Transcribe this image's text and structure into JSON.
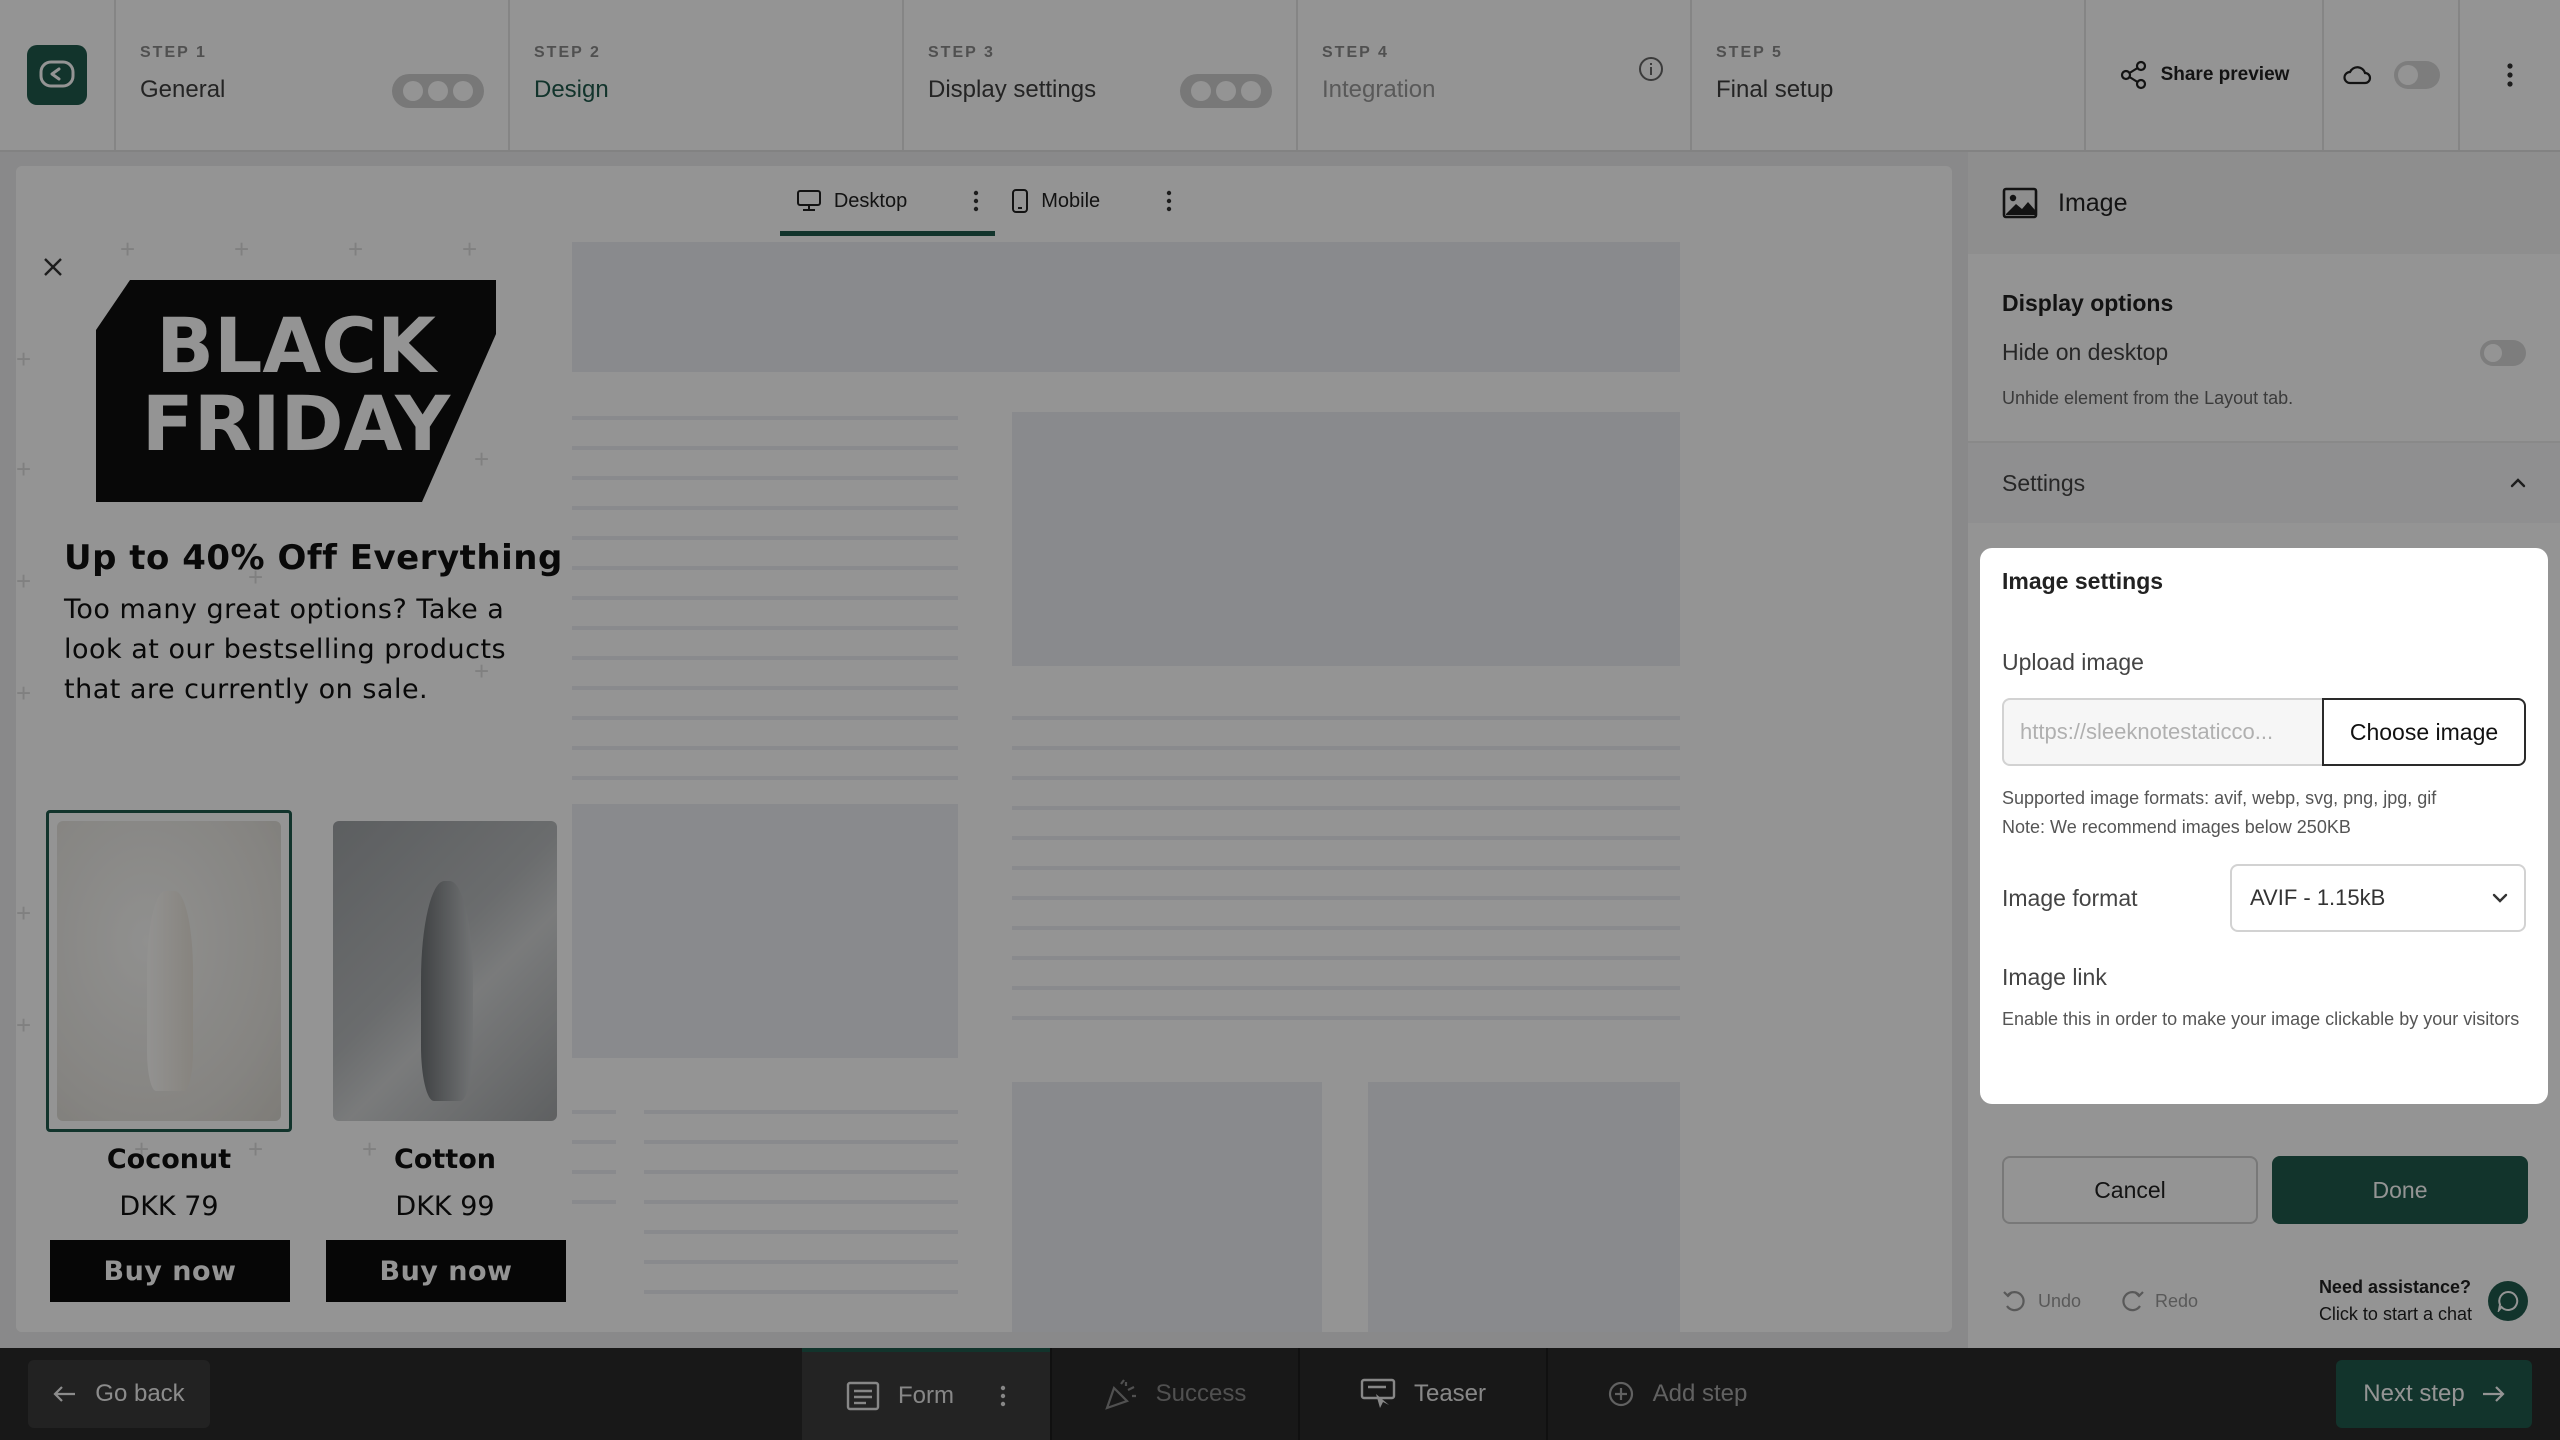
{
  "steps": [
    {
      "num": "STEP 1",
      "name": "General"
    },
    {
      "num": "STEP 2",
      "name": "Design"
    },
    {
      "num": "STEP 3",
      "name": "Display settings"
    },
    {
      "num": "STEP 4",
      "name": "Integration"
    },
    {
      "num": "STEP 5",
      "name": "Final setup"
    }
  ],
  "topbar": {
    "share_label": "Share preview"
  },
  "device_tabs": {
    "desktop": "Desktop",
    "mobile": "Mobile"
  },
  "popup": {
    "logo_line1": "BLACK",
    "logo_line2": "FRIDAY",
    "heading": "Up to 40% Off Everything",
    "body": "Too many great options? Take a look at our bestselling products that are currently on sale.",
    "products": [
      {
        "name": "Coconut",
        "price": "DKK 79",
        "cta": "Buy now"
      },
      {
        "name": "Cotton",
        "price": "DKK 99",
        "cta": "Buy now"
      }
    ]
  },
  "panel": {
    "title": "Image",
    "display_title": "Display options",
    "hide_label": "Hide on desktop",
    "hide_hint": "Unhide element from the Layout tab.",
    "settings_label": "Settings",
    "image_settings": {
      "title": "Image settings",
      "upload_label": "Upload image",
      "upload_value": "https://sleeknotestaticco...",
      "choose_label": "Choose image",
      "formats_line1": "Supported image formats: avif, webp, svg, png, jpg, gif",
      "formats_line2": "Note: We recommend images below 250KB",
      "format_label": "Image format",
      "format_value": "AVIF - 1.15kB",
      "link_label": "Image link",
      "link_hint": "Enable this in order to make your image clickable by your visitors"
    },
    "cancel_label": "Cancel",
    "done_label": "Done",
    "undo_label": "Undo",
    "redo_label": "Redo",
    "assist_line1": "Need assistance?",
    "assist_line2": "Click to start a chat"
  },
  "bottombar": {
    "go_back": "Go back",
    "tabs": [
      {
        "label": "Form"
      },
      {
        "label": "Success"
      },
      {
        "label": "Teaser"
      },
      {
        "label": "Add step"
      }
    ],
    "next_step": "Next step"
  },
  "colors": {
    "brand": "#1f5a4c",
    "overlay": "rgba(0,0,0,0.42)"
  }
}
